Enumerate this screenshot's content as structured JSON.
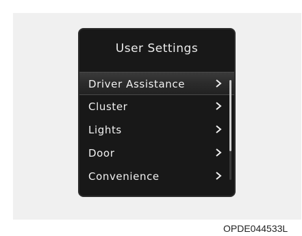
{
  "screen": {
    "title": "User Settings",
    "items": [
      {
        "label": "Driver Assistance",
        "selected": true
      },
      {
        "label": "Cluster",
        "selected": false
      },
      {
        "label": "Lights",
        "selected": false
      },
      {
        "label": "Door",
        "selected": false
      },
      {
        "label": "Convenience",
        "selected": false
      }
    ],
    "scroll_position_fraction": 0
  },
  "figure_code": "OPDE044533L",
  "colors": {
    "screen_background": "#181818",
    "text": "#f1f1f1",
    "selection_highlight": "#2e2e2e"
  },
  "icons": {
    "item_arrow": "chevron-right-icon"
  }
}
